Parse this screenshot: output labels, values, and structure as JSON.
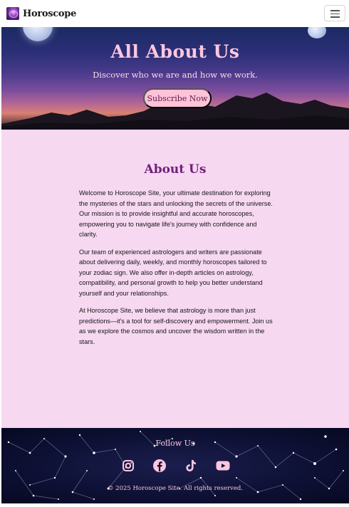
{
  "navbar": {
    "brand_name": "Horoscope",
    "logo_icon": "horoscope-logo-icon",
    "menu_icon": "hamburger-menu-icon"
  },
  "hero": {
    "title": "All About Us",
    "subtitle": "Discover who we are and how we work.",
    "cta_label": "Subscribe Now"
  },
  "about": {
    "heading": "About Us",
    "paragraphs": [
      "Welcome to Horoscope Site, your ultimate destination for exploring the mysteries of the stars and unlocking the secrets of the universe. Our mission is to provide insightful and accurate horoscopes, empowering you to navigate life's journey with confidence and clarity.",
      "Our team of experienced astrologers and writers are passionate about delivering daily, weekly, and monthly horoscopes tailored to your zodiac sign. We also offer in-depth articles on astrology, compatibility, and personal growth to help you better understand yourself and your relationships.",
      "At Horoscope Site, we believe that astrology is more than just predictions—it's a tool for self-discovery and empowerment. Join us as we explore the cosmos and uncover the wisdom written in the stars."
    ]
  },
  "footer": {
    "follow_label": "Follow Us",
    "socials": [
      "instagram-icon",
      "facebook-icon",
      "tiktok-icon",
      "youtube-icon"
    ],
    "copyright": "© 2025 Horoscope Site. All rights reserved."
  },
  "colors": {
    "accent_pink": "#ffc7df",
    "heading_purple": "#6f1f7a",
    "main_bg": "#f7d8f1",
    "footer_bg": "#0d1033"
  }
}
